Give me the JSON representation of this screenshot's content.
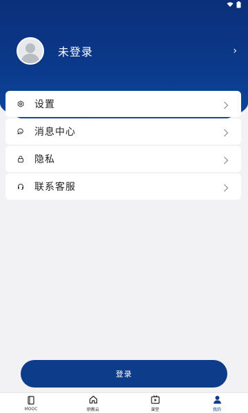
{
  "profile": {
    "name": "未登录",
    "avatar_icon": "default-avatar-icon",
    "arrow": "›"
  },
  "menu": [
    {
      "label": "设置",
      "icon": "gear-icon"
    },
    {
      "label": "消息中心",
      "icon": "chat-icon"
    },
    {
      "label": "隐私",
      "icon": "lock-icon"
    },
    {
      "label": "联系客服",
      "icon": "headset-icon"
    }
  ],
  "login_button": {
    "label": "登录"
  },
  "tabbar": [
    {
      "label": "MOOC",
      "icon": "book-icon"
    },
    {
      "label": "职教云",
      "icon": "home-icon"
    },
    {
      "label": "课堂",
      "icon": "play-icon"
    },
    {
      "label": "我的",
      "icon": "user-icon",
      "active": true
    }
  ],
  "colors": {
    "header": "#0b3a8c",
    "accent": "#0c3c8a",
    "background": "#f2f2f4"
  }
}
